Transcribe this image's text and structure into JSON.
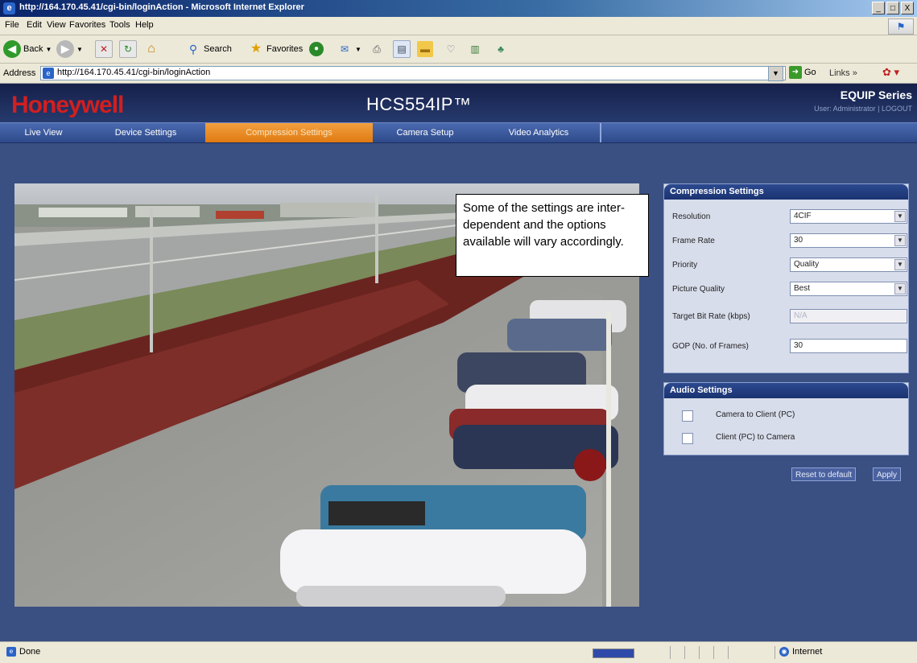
{
  "window": {
    "title": "http://164.170.45.41/cgi-bin/loginAction - Microsoft Internet Explorer",
    "controls": {
      "minimize": "_",
      "maximize": "□",
      "close": "X"
    }
  },
  "menu": [
    "File",
    "Edit",
    "View",
    "Favorites",
    "Tools",
    "Help"
  ],
  "toolbar": {
    "back": "Back",
    "search": "Search",
    "favorites": "Favorites"
  },
  "address": {
    "label": "Address",
    "url": "http://164.170.45.41/cgi-bin/loginAction",
    "go": "Go",
    "links": "Links"
  },
  "header": {
    "logo": "Honeywell",
    "product": "HCS554IP™",
    "series": "EQUIP Series",
    "user_line": "User: Administrator | LOGOUT"
  },
  "nav": {
    "tabs": [
      {
        "label": "Live View",
        "active": false
      },
      {
        "label": "Device Settings",
        "active": false
      },
      {
        "label": "Compression Settings",
        "active": true
      },
      {
        "label": "Camera Setup",
        "active": false
      },
      {
        "label": "Video Analytics",
        "active": false
      }
    ]
  },
  "callout": {
    "text": "Some of the settings are inter-dependent and the options available will vary accordingly."
  },
  "compression": {
    "title": "Compression Settings",
    "fields": [
      {
        "label": "Resolution",
        "value": "4CIF",
        "type": "select"
      },
      {
        "label": "Frame Rate",
        "value": "30",
        "type": "select"
      },
      {
        "label": "Priority",
        "value": "Quality",
        "type": "select"
      },
      {
        "label": "Picture Quality",
        "value": "Best",
        "type": "select"
      },
      {
        "label": "Target Bit Rate (kbps)",
        "value": "N/A",
        "type": "text-disabled"
      },
      {
        "label": "GOP (No. of Frames)",
        "value": "30",
        "type": "text"
      }
    ]
  },
  "audio": {
    "title": "Audio Settings",
    "options": [
      {
        "label": "Camera to Client (PC)",
        "checked": false
      },
      {
        "label": "Client (PC) to Camera",
        "checked": false
      }
    ]
  },
  "buttons": {
    "reset": "Reset to default",
    "apply": "Apply"
  },
  "status": {
    "text": "Done",
    "zone": "Internet",
    "progress": 1.0
  },
  "colors": {
    "brand_red": "#d21f1f",
    "page_bg": "#3a4f82",
    "active_tab": "#e07a10"
  }
}
